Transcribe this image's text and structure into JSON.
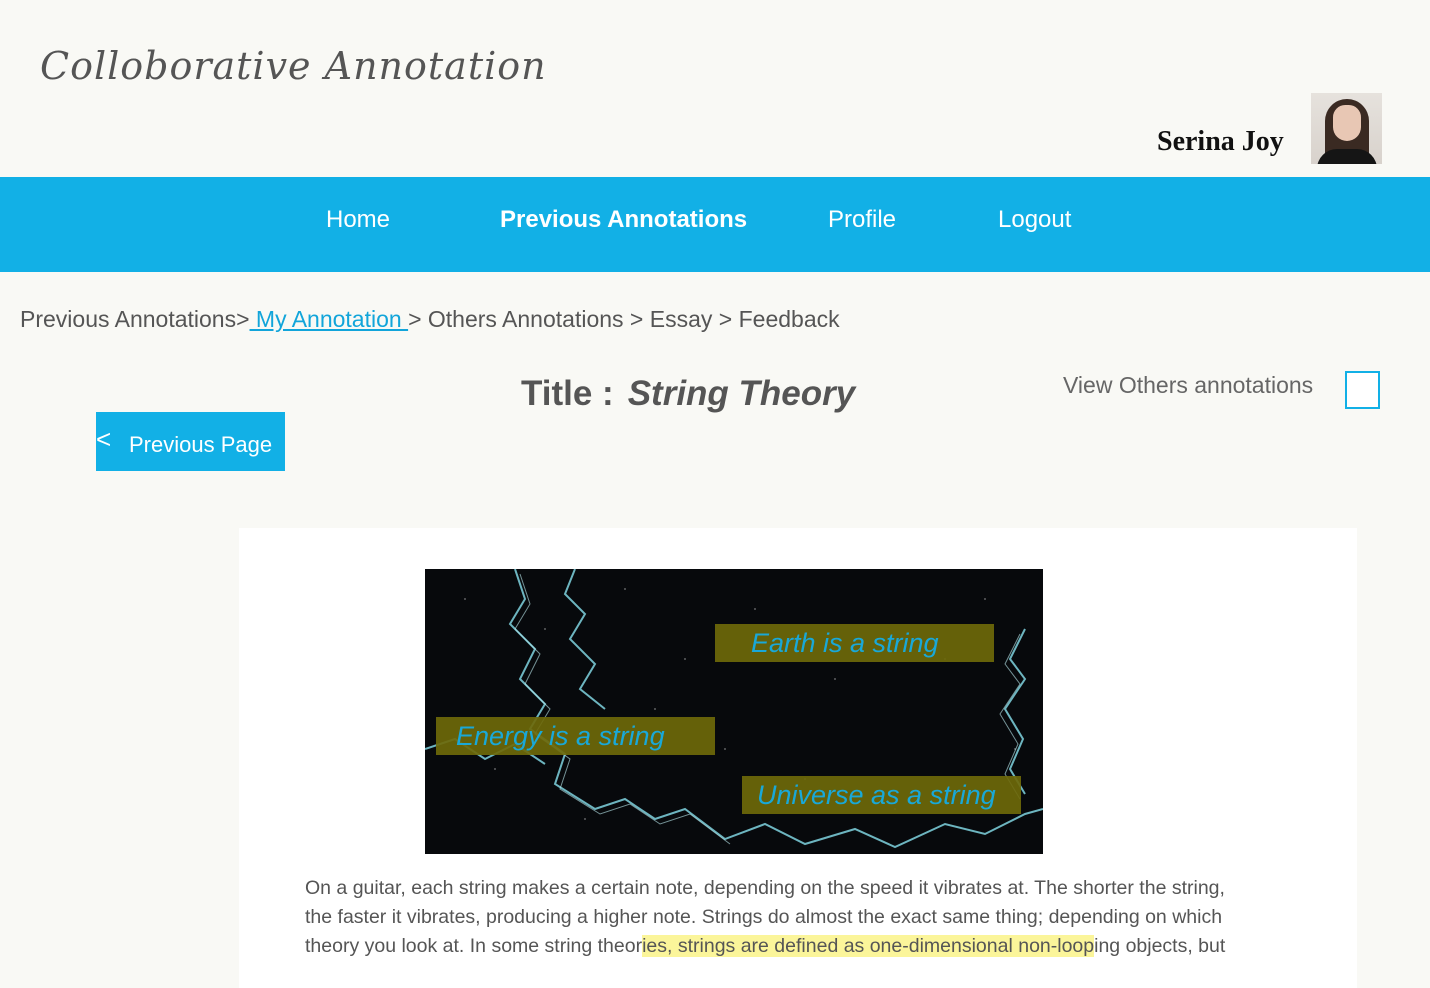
{
  "app": {
    "title": "Colloborative Annotation"
  },
  "user": {
    "name": "Serina Joy"
  },
  "nav": {
    "items": [
      {
        "label": "Home"
      },
      {
        "label": "Previous Annotations"
      },
      {
        "label": "Profile"
      },
      {
        "label": "Logout"
      }
    ]
  },
  "breadcrumb": {
    "items": [
      {
        "label": "Previous Annotations>"
      },
      {
        "label": " My Annotation  "
      },
      {
        "label": " > Others Annotations"
      },
      {
        "label": " > Essay"
      },
      {
        "label": " > Feedback"
      }
    ]
  },
  "page": {
    "title_label": "Title :",
    "title_value": "String Theory",
    "view_others_label": "View Others annotations",
    "prev_button_icon": "<",
    "prev_button_label": "Previous Page"
  },
  "image_tags": [
    {
      "label": "Earth is a string"
    },
    {
      "label": "Energy is a string"
    },
    {
      "label": "Universe as a string"
    }
  ],
  "essay": {
    "line1": "On a guitar, each string makes a certain note, depending on the speed it vibrates at. The shorter the string,",
    "line2": "the faster it vibrates, producing a higher note. Strings do almost the exact same thing; depending on which",
    "line3_a": "theory you look at. In some string theor",
    "line3_b": "ies, strings are defined as one-dimensional non-loop",
    "line3_c": "ing objects, but"
  },
  "colors": {
    "accent": "#12b0e6",
    "tag_background": "#6e690a",
    "tag_text": "#19a8d8",
    "highlight": "#fbf59a"
  }
}
